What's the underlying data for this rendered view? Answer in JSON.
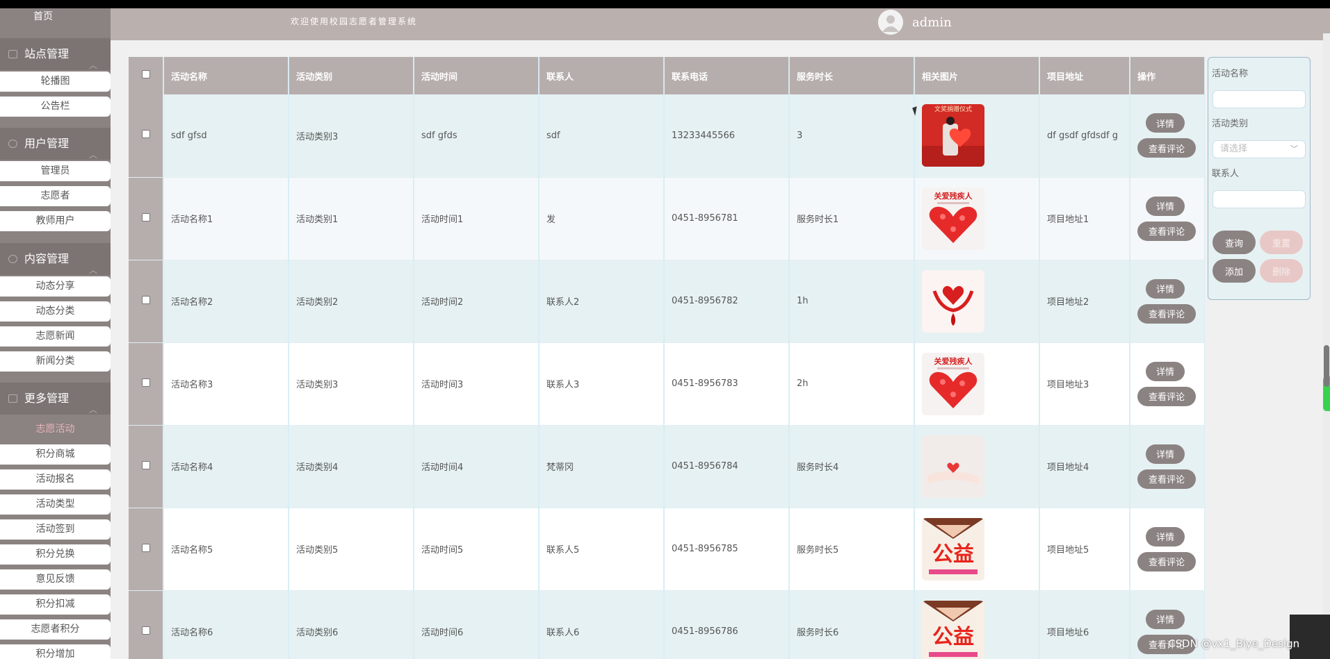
{
  "header": {
    "welcome": "欢迎使用校园志愿者管理系统",
    "username": "admin"
  },
  "sidebar": {
    "home": "首页",
    "groups": [
      {
        "label": "站点管理",
        "items": [
          "轮播图",
          "公告栏"
        ]
      },
      {
        "label": "用户管理",
        "items": [
          "管理员",
          "志愿者",
          "教师用户"
        ]
      },
      {
        "label": "内容管理",
        "items": [
          "动态分享",
          "动态分类",
          "志愿新闻",
          "新闻分类"
        ]
      },
      {
        "label": "更多管理",
        "items": [
          "志愿活动",
          "积分商城",
          "活动报名",
          "活动类型",
          "活动签到",
          "积分兑换",
          "意见反馈",
          "积分扣减",
          "志愿者积分",
          "积分增加"
        ]
      }
    ],
    "active_item": "志愿活动"
  },
  "table": {
    "columns": [
      "活动名称",
      "活动类别",
      "活动时间",
      "联系人",
      "联系电话",
      "服务时长",
      "相关图片",
      "项目地址",
      "操作"
    ],
    "rows": [
      {
        "name": "sdf gfsd",
        "category": "活动类别3",
        "time": "sdf gfds",
        "contact": "sdf",
        "phone": "13233445566",
        "duration": "3",
        "address": "df gsdf gfdsdf g",
        "image": "red-ceremony-photo"
      },
      {
        "name": "活动名称1",
        "category": "活动类别1",
        "time": "活动时间1",
        "contact": "发",
        "phone": "0451-8956781",
        "duration": "服务时长1",
        "address": "项目地址1",
        "image": "heart-poster"
      },
      {
        "name": "活动名称2",
        "category": "活动类别2",
        "time": "活动时间2",
        "contact": "联系人2",
        "phone": "0451-8956782",
        "duration": "1h",
        "address": "项目地址2",
        "image": "hands-heart-poster"
      },
      {
        "name": "活动名称3",
        "category": "活动类别3",
        "time": "活动时间3",
        "contact": "联系人3",
        "phone": "0451-8956783",
        "duration": "2h",
        "address": "项目地址3",
        "image": "heart-poster"
      },
      {
        "name": "活动名称4",
        "category": "活动类别4",
        "time": "活动时间4",
        "contact": "梵蒂冈",
        "phone": "0451-8956784",
        "duration": "服务时长4",
        "address": "项目地址4",
        "image": "hand-heart-photo"
      },
      {
        "name": "活动名称5",
        "category": "活动类别5",
        "time": "活动时间5",
        "contact": "联系人5",
        "phone": "0451-8956785",
        "duration": "服务时长5",
        "address": "项目地址5",
        "image": "gongyi-poster"
      },
      {
        "name": "活动名称6",
        "category": "活动类别6",
        "time": "活动时间6",
        "contact": "联系人6",
        "phone": "0451-8956786",
        "duration": "服务时长6",
        "address": "项目地址6",
        "image": "gongyi-poster"
      }
    ],
    "image_texts": {
      "heart-poster": "关爱残疾人",
      "gongyi-poster": "公益",
      "red-ceremony-photo": "文奖捐赠仪式"
    },
    "actions": {
      "detail": "详情",
      "comment": "查看评论"
    }
  },
  "search": {
    "name_label": "活动名称",
    "category_label": "活动类别",
    "category_placeholder": "请选择",
    "contact_label": "联系人",
    "query": "查询",
    "reset": "重置",
    "add": "添加",
    "delete": "删除"
  },
  "watermark": "CSDN @vx1_Biye_Design",
  "colors": {
    "header_bg": "#bab0ae",
    "sidebar_bg": "#8b8382",
    "button_bg": "#8b8382",
    "active_text": "#e8b1b6"
  }
}
